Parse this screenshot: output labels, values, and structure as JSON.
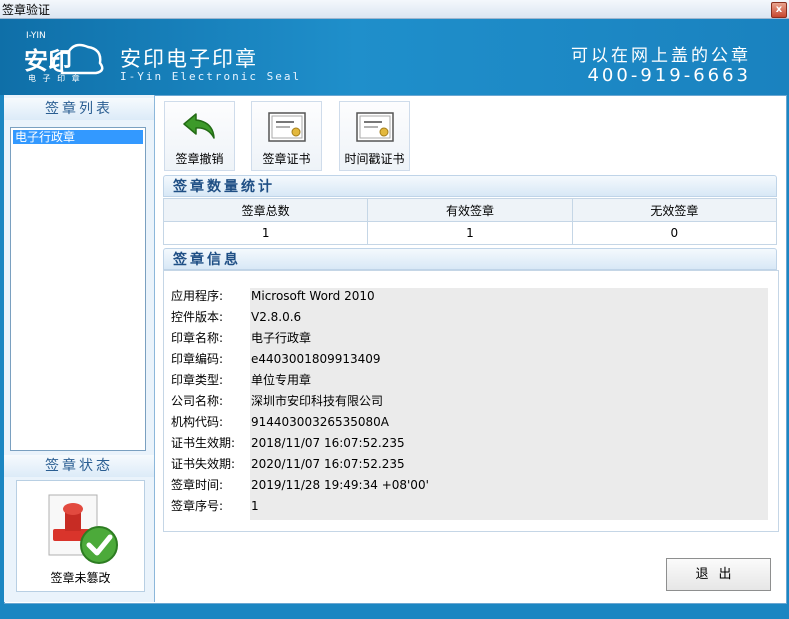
{
  "window": {
    "title": "签章验证",
    "close_glyph": "x"
  },
  "header": {
    "logo_top": "I-YIN",
    "logo_main": "安印",
    "logo_bottom": "电 子 印 章",
    "brand_cn": "安印电子印章",
    "brand_en": "I-Yin Electronic Seal",
    "slogan": "可以在网上盖的公章",
    "phone": "400-919-6663"
  },
  "left": {
    "list_title": "签章列表",
    "list_items": [
      "电子行政章"
    ],
    "status_title": "签章状态",
    "status_text": "签章未篡改"
  },
  "toolbar": {
    "revoke_label": "签章撤销",
    "cert_label": "签章证书",
    "timestamp_label": "时间戳证书"
  },
  "stats": {
    "title": "签章数量统计",
    "headers": [
      "签章总数",
      "有效签章",
      "无效签章"
    ],
    "values": [
      "1",
      "1",
      "0"
    ]
  },
  "info": {
    "title": "签章信息",
    "rows": [
      {
        "key": "应用程序:",
        "value": "Microsoft Word 2010"
      },
      {
        "key": "控件版本:",
        "value": "V2.8.0.6"
      },
      {
        "key": "印章名称:",
        "value": "电子行政章"
      },
      {
        "key": "印章编码:",
        "value": "e4403001809913409"
      },
      {
        "key": "印章类型:",
        "value": "单位专用章"
      },
      {
        "key": "公司名称:",
        "value": "深圳市安印科技有限公司"
      },
      {
        "key": "机构代码:",
        "value": "91440300326535080A"
      },
      {
        "key": "证书生效期:",
        "value": "2018/11/07 16:07:52.235"
      },
      {
        "key": "证书失效期:",
        "value": "2020/11/07 16:07:52.235"
      },
      {
        "key": "签章时间:",
        "value": "2019/11/28 19:49:34 +08'00'"
      },
      {
        "key": "签章序号:",
        "value": "1"
      }
    ]
  },
  "exit_label": "退出",
  "colors": {
    "header_blue": "#1a82bf",
    "section_text": "#1f4f85",
    "selection": "#3399ff"
  }
}
